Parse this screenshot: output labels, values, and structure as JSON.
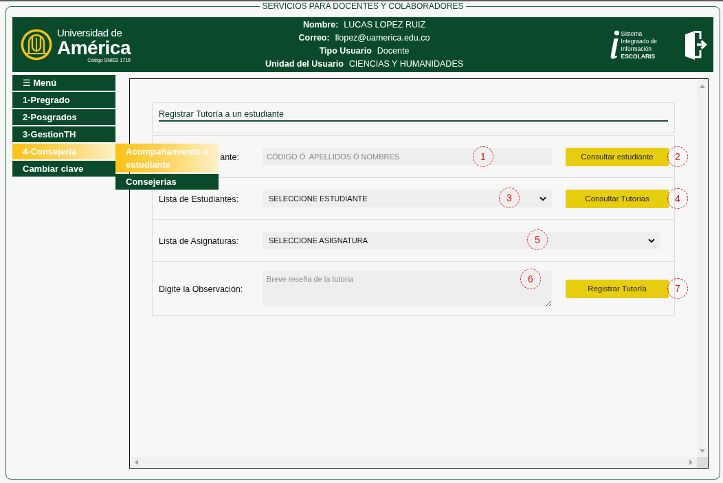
{
  "page": {
    "legend": "SERVICIOS PARA DOCENTES Y COLABORADORES"
  },
  "header": {
    "logo": {
      "line_1": "Universidad de",
      "line_2": "América",
      "caption": "Código SNIES 1715"
    },
    "user_info": [
      {
        "label": "Nombre:",
        "value": "LUCAS LOPEZ RUIZ"
      },
      {
        "label": "Correo:",
        "value": "llopez@uamerica.edu.co"
      },
      {
        "label": "Tipo Usuario",
        "value": "Docente"
      },
      {
        "label": "Unidad del Usuario",
        "value": "CIENCIAS Y HUMANIDADES"
      }
    ],
    "system_logo": {
      "lines": [
        "Sistema",
        "Integraado de",
        "Información"
      ],
      "name": "ESCOLARIS"
    }
  },
  "menu": {
    "title": "☰ Menú",
    "items": [
      {
        "label": "1-Pregrado",
        "selected": false
      },
      {
        "label": "2-Posgrados",
        "selected": false
      },
      {
        "label": "3-GestionTH",
        "selected": false
      },
      {
        "label": "4-Consejería",
        "selected": true,
        "submenu": [
          {
            "label": "Acompañamiento a estudiante",
            "selected": true
          },
          {
            "label": "Consejerias",
            "selected": false
          }
        ]
      },
      {
        "label": "Cambiar clave",
        "selected": false
      }
    ]
  },
  "form": {
    "title": "Registrar Tutoría a un estudiante",
    "rows": [
      {
        "kind": "text",
        "label": "ante:",
        "placeholder": "CÓDIGO Ó  APELLIDOS Ó NOMBRES",
        "field_callout": "1",
        "button": "Consultar estudiante",
        "button_callout": "2"
      },
      {
        "kind": "select",
        "label": "Lista de Estudiantes:",
        "value": "SELECCIONE ESTUDIANTE",
        "field_callout": "3",
        "button": "Consultar Tutorias",
        "button_callout": "4"
      },
      {
        "kind": "select",
        "label": "Lista de Asignaturas:",
        "value": "SELECCIONE ASIGNATURA",
        "field_callout": "5"
      },
      {
        "kind": "textarea",
        "label": "Digite la Observación:",
        "placeholder": "Breve reseña de la tutoria",
        "field_callout": "6",
        "button": "Registrar Tutoría",
        "button_callout": "7"
      }
    ]
  }
}
